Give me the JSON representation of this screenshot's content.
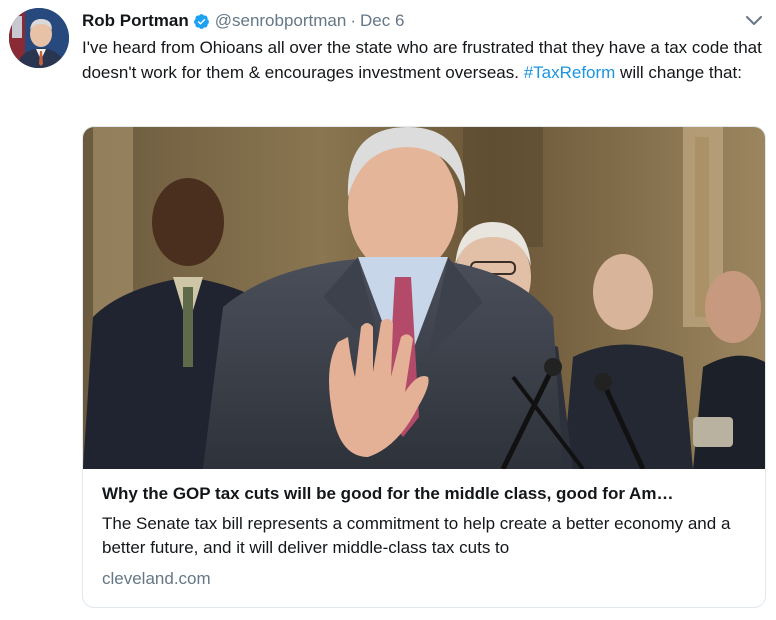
{
  "tweet": {
    "author_name": "Rob Portman",
    "handle": "@senrobportman",
    "separator": "·",
    "date": "Dec 6",
    "text_before": "I've heard from Ohioans all over the state who are frustrated that they have a tax code that doesn't work for them & encourages investment overseas. ",
    "hashtag": "#TaxReform",
    "text_after": " will change that:",
    "verified_icon": "verified-badge-icon",
    "menu_icon": "chevron-down-icon"
  },
  "card": {
    "image_alt": "press-conference-photo",
    "title": "Why the GOP tax cuts will be good for the middle class, good for Am…",
    "description": "The Senate tax bill represents a commitment to help create a better economy and a better future, and it will deliver middle-class tax cuts to",
    "domain": "cleveland.com"
  },
  "colors": {
    "link": "#1b95e0",
    "secondary_text": "#657786",
    "border": "#e1e8ed"
  }
}
